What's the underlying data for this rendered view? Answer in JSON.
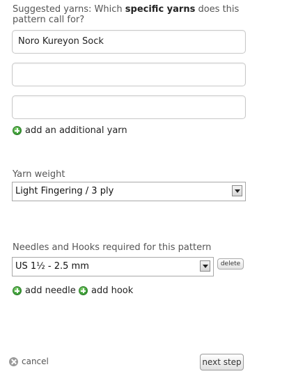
{
  "suggested_yarns": {
    "label_prefix": "Suggested yarns: Which ",
    "label_bold": "specific yarns",
    "label_suffix": " does this",
    "label_line2": "pattern call for?",
    "inputs": [
      "Noro Kureyon Sock",
      "",
      ""
    ],
    "add_link": "add an additional yarn"
  },
  "yarn_weight": {
    "label": "Yarn weight",
    "selected": "Light Fingering / 3 ply"
  },
  "needles": {
    "label": "Needles and Hooks required for this pattern",
    "selected": "US 1½ - 2.5 mm",
    "delete_label": "delete",
    "add_needle": "add needle",
    "add_hook": "add hook"
  },
  "footer": {
    "cancel_label": "cancel",
    "next_label": "next step"
  },
  "colors": {
    "add_icon": "#3fa23a",
    "cancel_icon": "#9a9a9a"
  }
}
